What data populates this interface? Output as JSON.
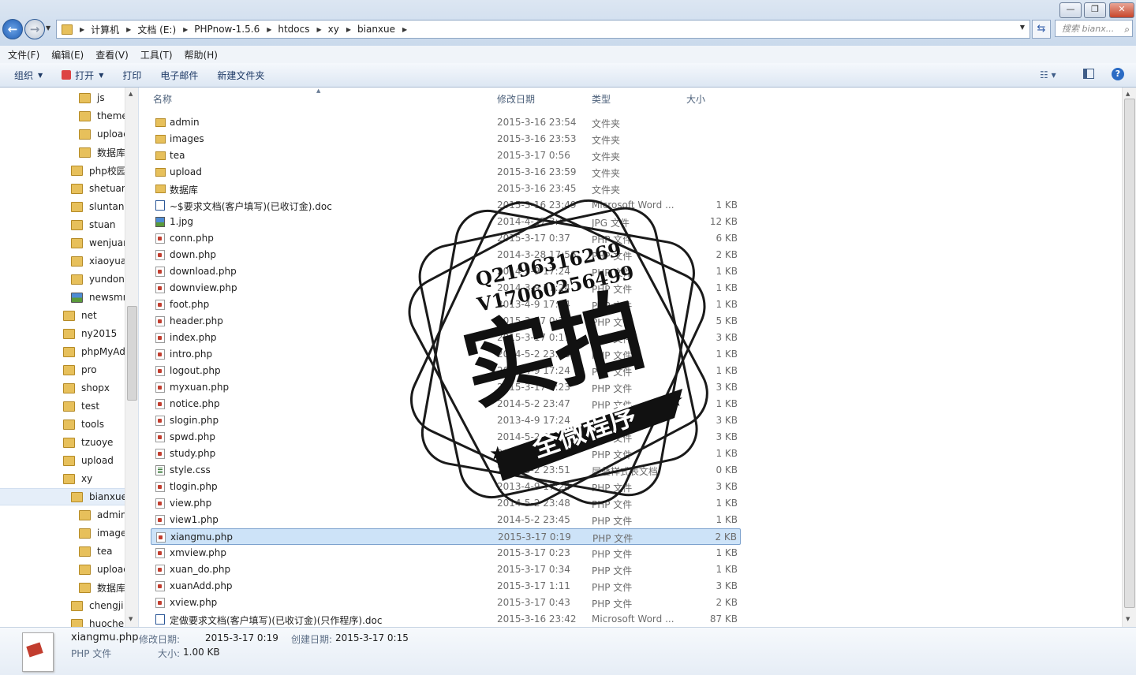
{
  "window": {
    "minimize_glyph": "—",
    "maximize_glyph": "❐",
    "close_glyph": "✕"
  },
  "address": {
    "breadcrumbs": [
      "计算机",
      "文档 (E:)",
      "PHPnow-1.5.6",
      "htdocs",
      "xy",
      "bianxue"
    ],
    "search_placeholder": "搜索 bianx..."
  },
  "menu": [
    "文件(F)",
    "编辑(E)",
    "查看(V)",
    "工具(T)",
    "帮助(H)"
  ],
  "toolbar": {
    "organize": "组织",
    "open": "打开",
    "print": "打印",
    "email": "电子邮件",
    "new_folder": "新建文件夹"
  },
  "nav_tree": [
    {
      "label": "js",
      "indent": 3
    },
    {
      "label": "themes",
      "indent": 3
    },
    {
      "label": "upload",
      "indent": 3
    },
    {
      "label": "数据库",
      "indent": 3
    },
    {
      "label": "php校园交",
      "indent": 2
    },
    {
      "label": "shetuan",
      "indent": 2
    },
    {
      "label": "sluntan",
      "indent": 2
    },
    {
      "label": "stuan",
      "indent": 2
    },
    {
      "label": "wenjuan",
      "indent": 2
    },
    {
      "label": "xiaoyuan",
      "indent": 2
    },
    {
      "label": "yundong",
      "indent": 2
    },
    {
      "label": "newsmmr",
      "indent": 2,
      "pic": true
    },
    {
      "label": "net",
      "indent": 1
    },
    {
      "label": "ny2015",
      "indent": 1
    },
    {
      "label": "phpMyAdm",
      "indent": 1
    },
    {
      "label": "pro",
      "indent": 1
    },
    {
      "label": "shopx",
      "indent": 1
    },
    {
      "label": "test",
      "indent": 1
    },
    {
      "label": "tools",
      "indent": 1
    },
    {
      "label": "tzuoye",
      "indent": 1
    },
    {
      "label": "upload",
      "indent": 1
    },
    {
      "label": "xy",
      "indent": 1
    },
    {
      "label": "bianxue",
      "indent": 2,
      "selected": true
    },
    {
      "label": "admin",
      "indent": 3
    },
    {
      "label": "images",
      "indent": 3
    },
    {
      "label": "tea",
      "indent": 3
    },
    {
      "label": "upload",
      "indent": 3
    },
    {
      "label": "数据库",
      "indent": 3
    },
    {
      "label": "chengji",
      "indent": 2
    },
    {
      "label": "huoche",
      "indent": 2
    }
  ],
  "columns": {
    "name": "名称",
    "date": "修改日期",
    "type": "类型",
    "size": "大小"
  },
  "files": [
    {
      "name": "admin",
      "date": "2015-3-16 23:54",
      "type": "文件夹",
      "size": "",
      "icon": "folder"
    },
    {
      "name": "images",
      "date": "2015-3-16 23:53",
      "type": "文件夹",
      "size": "",
      "icon": "folder"
    },
    {
      "name": "tea",
      "date": "2015-3-17 0:56",
      "type": "文件夹",
      "size": "",
      "icon": "folder"
    },
    {
      "name": "upload",
      "date": "2015-3-16 23:59",
      "type": "文件夹",
      "size": "",
      "icon": "folder"
    },
    {
      "name": "数据库",
      "date": "2015-3-16 23:45",
      "type": "文件夹",
      "size": "",
      "icon": "folder"
    },
    {
      "name": "~$要求文档(客户填写)(已收订金).doc",
      "date": "2015-3-16 23:49",
      "type": "Microsoft Word ...",
      "size": "1 KB",
      "icon": "doc"
    },
    {
      "name": "1.jpg",
      "date": "2014-4-27 3:4",
      "type": "JPG 文件",
      "size": "12 KB",
      "icon": "jpg"
    },
    {
      "name": "conn.php",
      "date": "2015-3-17 0:37",
      "type": "PHP 文件",
      "size": "6 KB",
      "icon": "php"
    },
    {
      "name": "down.php",
      "date": "2014-3-28 17:56",
      "type": "PHP 文件",
      "size": "2 KB",
      "icon": "php"
    },
    {
      "name": "download.php",
      "date": "2014-3-9 17:24",
      "type": "PHP 文件",
      "size": "1 KB",
      "icon": "php"
    },
    {
      "name": "downview.php",
      "date": "2014-3-9 17:24",
      "type": "PHP 文件",
      "size": "1 KB",
      "icon": "php"
    },
    {
      "name": "foot.php",
      "date": "2013-4-9 17:24",
      "type": "PHP 文件",
      "size": "1 KB",
      "icon": "php"
    },
    {
      "name": "header.php",
      "date": "2015-3-17 0:37",
      "type": "PHP 文件",
      "size": "5 KB",
      "icon": "php"
    },
    {
      "name": "index.php",
      "date": "2015-3-17 0:17",
      "type": "PHP 文件",
      "size": "3 KB",
      "icon": "php"
    },
    {
      "name": "intro.php",
      "date": "2014-5-2 23:48",
      "type": "PHP 文件",
      "size": "1 KB",
      "icon": "php"
    },
    {
      "name": "logout.php",
      "date": "2013-4-9 17:24",
      "type": "PHP 文件",
      "size": "1 KB",
      "icon": "php"
    },
    {
      "name": "myxuan.php",
      "date": "2015-3-17 0:23",
      "type": "PHP 文件",
      "size": "3 KB",
      "icon": "php"
    },
    {
      "name": "notice.php",
      "date": "2014-5-2 23:47",
      "type": "PHP 文件",
      "size": "1 KB",
      "icon": "php"
    },
    {
      "name": "slogin.php",
      "date": "2013-4-9 17:24",
      "type": "PHP 文件",
      "size": "3 KB",
      "icon": "php"
    },
    {
      "name": "spwd.php",
      "date": "2014-5-2 23:47",
      "type": "PHP 文件",
      "size": "3 KB",
      "icon": "php"
    },
    {
      "name": "study.php",
      "date": "2014-5-2 23:47",
      "type": "PHP 文件",
      "size": "1 KB",
      "icon": "php"
    },
    {
      "name": "style.css",
      "date": "2014-5-2 23:51",
      "type": "层叠样式表文档",
      "size": "0 KB",
      "icon": "css"
    },
    {
      "name": "tlogin.php",
      "date": "2013-4-9 17:24",
      "type": "PHP 文件",
      "size": "3 KB",
      "icon": "php"
    },
    {
      "name": "view.php",
      "date": "2014-5-2 23:48",
      "type": "PHP 文件",
      "size": "1 KB",
      "icon": "php"
    },
    {
      "name": "view1.php",
      "date": "2014-5-2 23:45",
      "type": "PHP 文件",
      "size": "1 KB",
      "icon": "php"
    },
    {
      "name": "xiangmu.php",
      "date": "2015-3-17 0:19",
      "type": "PHP 文件",
      "size": "2 KB",
      "icon": "php",
      "selected": true
    },
    {
      "name": "xmview.php",
      "date": "2015-3-17 0:23",
      "type": "PHP 文件",
      "size": "1 KB",
      "icon": "php"
    },
    {
      "name": "xuan_do.php",
      "date": "2015-3-17 0:34",
      "type": "PHP 文件",
      "size": "1 KB",
      "icon": "php"
    },
    {
      "name": "xuanAdd.php",
      "date": "2015-3-17 1:11",
      "type": "PHP 文件",
      "size": "3 KB",
      "icon": "php"
    },
    {
      "name": "xview.php",
      "date": "2015-3-17 0:43",
      "type": "PHP 文件",
      "size": "2 KB",
      "icon": "php"
    },
    {
      "name": "定做要求文档(客户填写)(已收订金)(只作程序).doc",
      "date": "2015-3-16 23:42",
      "type": "Microsoft Word ...",
      "size": "87 KB",
      "icon": "doc"
    }
  ],
  "details": {
    "filename": "xiangmu.php",
    "filetype": "PHP 文件",
    "modified_label": "修改日期:",
    "modified_value": "2015-3-17 0:19",
    "created_label": "创建日期:",
    "created_value": "2015-3-17 0:15",
    "size_label": "大小:",
    "size_value": "1.00 KB"
  },
  "watermark": {
    "contact_line1": "Q2196316269",
    "contact_line2": "V17060256499",
    "big_text": "实拍",
    "banner_text": "全微程序"
  },
  "colors": {
    "selection_bg": "#cde3f8",
    "selection_border": "#7da2ce",
    "folder": "#e7c05b",
    "chrome": "#dce6f2"
  }
}
